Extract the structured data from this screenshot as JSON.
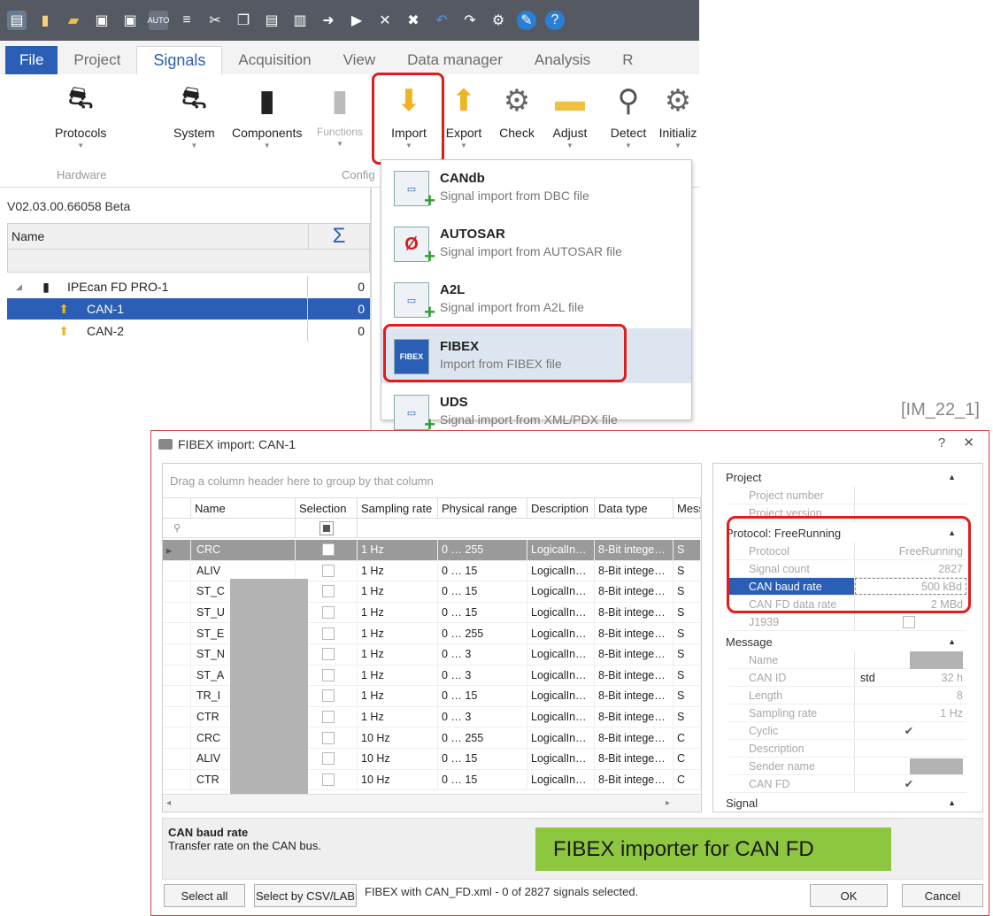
{
  "toolbar": {
    "icons": [
      "app-icon",
      "new-icon",
      "open-icon",
      "save-icon",
      "save-as-icon",
      "auto-icon",
      "list-icon",
      "cut-icon",
      "copy-icon",
      "paste-icon",
      "paste-special-icon",
      "import-small-icon",
      "export-small-icon",
      "delete-icon",
      "tools-icon",
      "undo-icon",
      "redo-icon",
      "settings-icon",
      "wrench-icon",
      "help-icon"
    ]
  },
  "tabs": [
    "File",
    "Project",
    "Signals",
    "Acquisition",
    "View",
    "Data manager",
    "Analysis",
    "R"
  ],
  "ribbon": {
    "buttons": [
      "Protocols",
      "System",
      "Components",
      "Functions",
      "Import",
      "Export",
      "Check",
      "Adjust",
      "Detect",
      "Initializ"
    ],
    "groups": [
      "Hardware",
      "Config"
    ]
  },
  "tree": {
    "version": "V02.03.00.66058 Beta",
    "col_name": "Name",
    "col_sum": "Σ",
    "rows": [
      {
        "name": "IPEcan FD PRO-1",
        "count": "0"
      },
      {
        "name": "CAN-1",
        "count": "0"
      },
      {
        "name": "CAN-2",
        "count": "0"
      }
    ]
  },
  "menu": {
    "items": [
      {
        "title": "CANdb",
        "sub": "Signal import from DBC file",
        "icon": "dbc"
      },
      {
        "title": "AUTOSAR",
        "sub": "Signal import from AUTOSAR file",
        "icon": "autosar"
      },
      {
        "title": "A2L",
        "sub": "Signal import from A2L file",
        "icon": "a2l"
      },
      {
        "title": "FIBEX",
        "sub": "Import from FIBEX file",
        "icon": "FIBEX"
      },
      {
        "title": "UDS",
        "sub": "Signal import from XML/PDX file",
        "icon": "uds"
      }
    ]
  },
  "ref_tag": "[IM_22_1]",
  "dialog": {
    "title": "FIBEX import: CAN-1",
    "controls": "? ✕",
    "group_hint": "Drag a column header here to group by that column",
    "columns": [
      "Name",
      "Selection",
      "Sampling rate",
      "Physical range",
      "Description",
      "Data type",
      "Mess"
    ],
    "rows": [
      {
        "name": "CRC",
        "rate": "1 Hz",
        "range": "0 … 255",
        "desc": "LogicalIn…",
        "type": "8-Bit intege…",
        "mess": "S"
      },
      {
        "name": "ALIV",
        "rate": "1 Hz",
        "range": "0 … 15",
        "desc": "LogicalIn…",
        "type": "8-Bit intege…",
        "mess": "S"
      },
      {
        "name": "ST_C",
        "rate": "1 Hz",
        "range": "0 … 15",
        "desc": "LogicalIn…",
        "type": "8-Bit intege…",
        "mess": "S"
      },
      {
        "name": "ST_U",
        "rate": "1 Hz",
        "range": "0 … 15",
        "desc": "LogicalIn…",
        "type": "8-Bit intege…",
        "mess": "S"
      },
      {
        "name": "ST_E",
        "rate": "1 Hz",
        "range": "0 … 255",
        "desc": "LogicalIn…",
        "type": "8-Bit intege…",
        "mess": "S"
      },
      {
        "name": "ST_N",
        "rate": "1 Hz",
        "range": "0 … 3",
        "desc": "LogicalIn…",
        "type": "8-Bit intege…",
        "mess": "S"
      },
      {
        "name": "ST_A",
        "rate": "1 Hz",
        "range": "0 … 3",
        "desc": "LogicalIn…",
        "type": "8-Bit intege…",
        "mess": "S"
      },
      {
        "name": "TR_I",
        "rate": "1 Hz",
        "range": "0 … 15",
        "desc": "LogicalIn…",
        "type": "8-Bit intege…",
        "mess": "S"
      },
      {
        "name": "CTR",
        "rate": "1 Hz",
        "range": "0 … 3",
        "desc": "LogicalIn…",
        "type": "8-Bit intege…",
        "mess": "S"
      },
      {
        "name": "CRC",
        "rate": "10 Hz",
        "range": "0 … 255",
        "desc": "LogicalIn…",
        "type": "8-Bit intege…",
        "mess": "C"
      },
      {
        "name": "ALIV",
        "rate": "10 Hz",
        "range": "0 … 15",
        "desc": "LogicalIn…",
        "type": "8-Bit intege…",
        "mess": "C"
      },
      {
        "name": "CTR",
        "rate": "10 Hz",
        "range": "0 … 15",
        "desc": "LogicalIn…",
        "type": "8-Bit intege…",
        "mess": "C"
      }
    ],
    "props": {
      "project_header": "Project",
      "project_rows": [
        {
          "k": "Project number",
          "v": ""
        },
        {
          "k": "Project version",
          "v": ""
        }
      ],
      "protocol_header": "Protocol: FreeRunning",
      "protocol_rows": [
        {
          "k": "Protocol",
          "v": "FreeRunning"
        },
        {
          "k": "Signal count",
          "v": "2827"
        },
        {
          "k": "CAN baud rate",
          "v": "500 kBd"
        },
        {
          "k": "CAN FD data rate",
          "v": "2 MBd"
        },
        {
          "k": "J1939",
          "v": ""
        }
      ],
      "message_header": "Message",
      "message_rows": [
        {
          "k": "Name",
          "v": ""
        },
        {
          "k": "CAN ID",
          "v": "32 h",
          "mid": "std"
        },
        {
          "k": "Length",
          "v": "8"
        },
        {
          "k": "Sampling rate",
          "v": "1 Hz"
        },
        {
          "k": "Cyclic",
          "v": "✔"
        },
        {
          "k": "Description",
          "v": ""
        },
        {
          "k": "Sender name",
          "v": ""
        },
        {
          "k": "CAN FD",
          "v": "✔"
        }
      ],
      "signal_header": "Signal"
    },
    "desc_title": "CAN baud rate",
    "desc_text": "Transfer rate on the CAN bus.",
    "banner": "FIBEX importer for CAN FD",
    "btn_select_all": "Select all",
    "btn_select_csv": "Select by CSV/LAB",
    "status": "FIBEX with CAN_FD.xml  -  0 of 2827 signals selected.",
    "btn_ok": "OK",
    "btn_cancel": "Cancel"
  }
}
